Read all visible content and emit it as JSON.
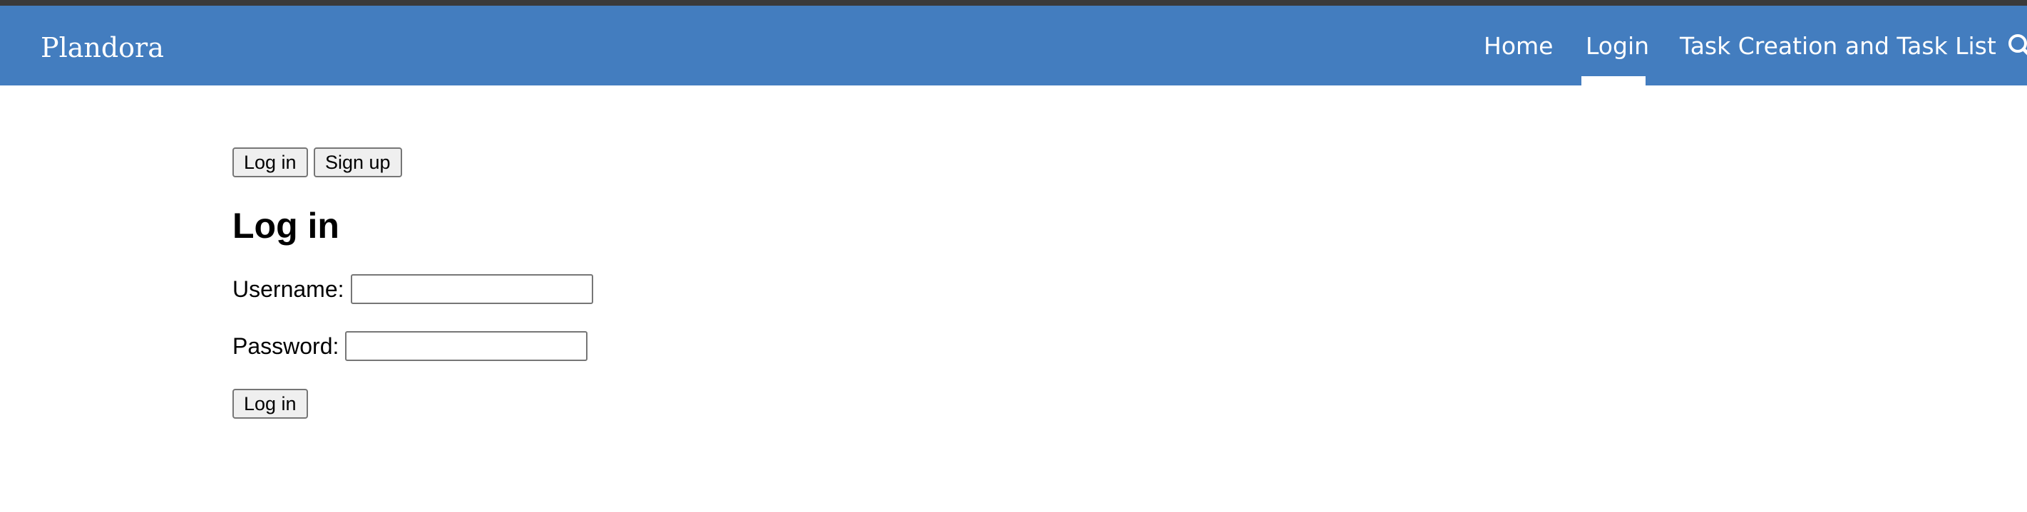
{
  "navbar": {
    "brand": "Plandora",
    "items": [
      {
        "label": "Home",
        "active": false
      },
      {
        "label": "Login",
        "active": true
      },
      {
        "label": "Task Creation and Task List",
        "active": false
      }
    ],
    "search_icon": "search-icon",
    "background_color": "#437dbf"
  },
  "auth_tabs": {
    "login_label": "Log in",
    "signup_label": "Sign up"
  },
  "form": {
    "heading": "Log in",
    "username_label": "Username:",
    "username_value": "",
    "password_label": "Password:",
    "password_value": "",
    "submit_label": "Log in"
  }
}
